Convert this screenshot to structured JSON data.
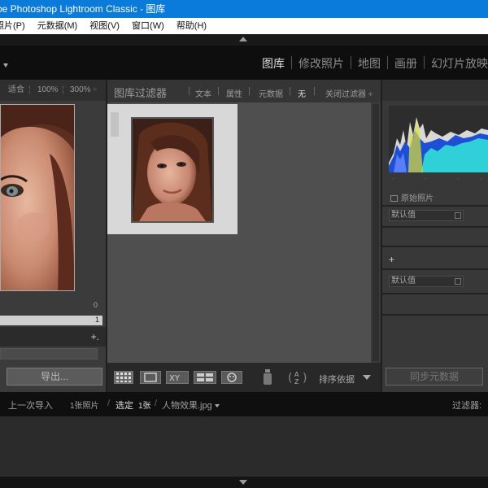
{
  "window": {
    "title": "be Photoshop Lightroom Classic - 图库"
  },
  "menu": {
    "items": [
      "照片(P)",
      "元数据(M)",
      "视图(V)",
      "窗口(W)",
      "帮助(H)"
    ]
  },
  "modules": {
    "items": [
      "图库",
      "修改照片",
      "地图",
      "画册",
      "幻灯片放映"
    ],
    "active": "图库"
  },
  "navigator": {
    "fit": "适合",
    "zoom1": "100%",
    "zoom2": "300%"
  },
  "left_panel": {
    "row_top_count": "0",
    "row_selected_count": "1",
    "plus": "+.",
    "export_button": "导出..."
  },
  "filter_bar": {
    "title": "图库过滤器",
    "text": "文本",
    "attribute": "属性",
    "metadata": "元数据",
    "none": "无",
    "close": "关闭过滤器 ÷"
  },
  "grid": {
    "cell_number": "1"
  },
  "toolbar": {
    "sort_label": "排序依据"
  },
  "right_panel": {
    "original_photo": "原始照片",
    "preset_default": "默认值",
    "plus": "+",
    "metadata_default": "默认值",
    "sync_button": "同步元数据",
    "histogram_colors": [
      "#1d4fd6",
      "#2fd0d8",
      "#e0e030",
      "#6a8aff",
      "#d8d8d8"
    ]
  },
  "filmstrip": {
    "previous_import": "上一次导入",
    "photo_count": "1张照片",
    "selected_prefix": "选定",
    "selected_count": "1张",
    "filename": "人物效果.jpg",
    "filter_label": "过滤器:"
  }
}
